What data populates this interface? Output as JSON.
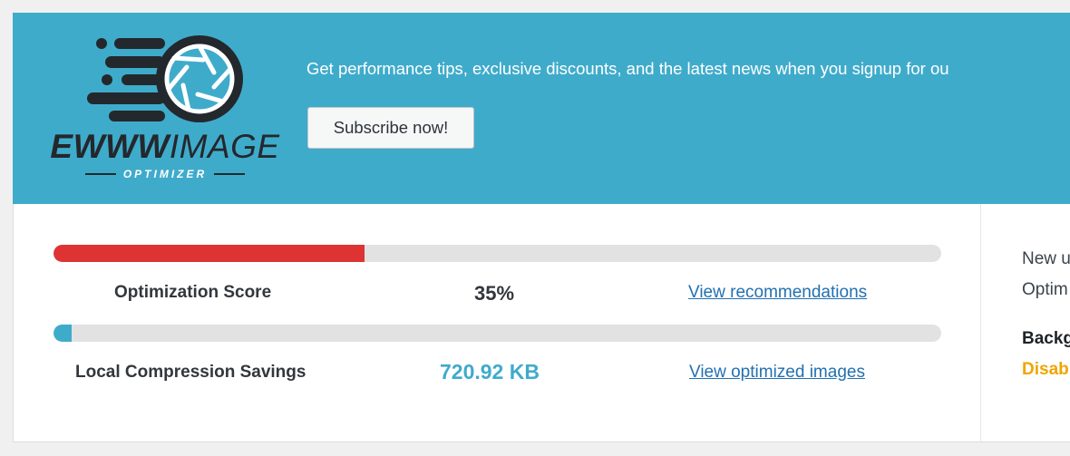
{
  "colors": {
    "banner": "#3fabcb",
    "score_bar": "#dd3333",
    "savings_bar": "#3fabcb",
    "savings_value": "#3fabcb",
    "link": "#2271b1",
    "status_orange": "#f0a500"
  },
  "banner": {
    "logo": {
      "wordmark_bold": "EWWW",
      "wordmark_light": "IMAGE",
      "subtitle": "OPTIMIZER",
      "icon": "camera-aperture-icon"
    },
    "message": "Get performance tips, exclusive discounts, and the latest news when you signup for ou",
    "subscribe_label": "Subscribe now!"
  },
  "metrics": {
    "score": {
      "label": "Optimization Score",
      "value_text": "35%",
      "progress": 0.35,
      "link": "View recommendations"
    },
    "savings": {
      "label": "Local Compression Savings",
      "value_text": "720.92 KB",
      "progress": 0.02,
      "link": "View optimized images"
    }
  },
  "side": {
    "line1": "New u",
    "line2": "Optim",
    "heading": "Backg",
    "status": "Disab"
  }
}
